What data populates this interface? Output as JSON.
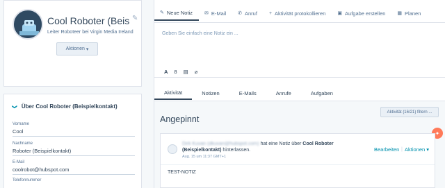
{
  "profile": {
    "name": "Cool Roboter (Beisp",
    "subtitle": "Leiter Roboteer bei Virgin Media Ireland",
    "actions_label": "Aktionen",
    "avatar_icon": "robot-avatar-icon"
  },
  "about": {
    "title": "Über Cool Roboter (Beispielkontakt)",
    "fields": [
      {
        "label": "Vorname",
        "value": "Cool"
      },
      {
        "label": "Nachname",
        "value": "Roboter (Beispielkontakt)"
      },
      {
        "label": "E-Mail",
        "value": "coolrobot@hubspot.com"
      },
      {
        "label": "Telefonnummer",
        "value": ""
      }
    ]
  },
  "top_tabs": [
    {
      "label": "Neue Notiz",
      "icon": "edit-icon"
    },
    {
      "label": "E-Mail",
      "icon": "email-icon"
    },
    {
      "label": "Anruf",
      "icon": "phone-icon"
    },
    {
      "label": "Aktivität protokollieren",
      "icon": "plus-icon"
    },
    {
      "label": "Aufgabe erstellen",
      "icon": "task-icon"
    },
    {
      "label": "Planen",
      "icon": "calendar-icon"
    }
  ],
  "note": {
    "placeholder": "Geben Sie einfach eine Notiz ein ...",
    "tools": [
      "A",
      "8",
      "▤",
      "⌀"
    ]
  },
  "sub_tabs": [
    "Aktivität",
    "Notizen",
    "E-Mails",
    "Anrufe",
    "Aufgaben"
  ],
  "activity": {
    "filter_label": "Aktivität (16/21) filtern ...",
    "pinned_title": "Angepinnt",
    "note_card": {
      "author": "Dirk Kuvan (dkuvan@hubspot.com)",
      "text_middle": "hat eine Notiz über",
      "contact": "Cool Roboter (Beispielkontakt)",
      "text_end": "hinterlassen.",
      "date": "Aug. 15 um 11:37 GMT+1",
      "edit_label": "Bearbeiten",
      "actions_label": "Aktionen",
      "body": "TEST-NOTIZ"
    }
  },
  "colors": {
    "accent": "#0091ae",
    "orange": "#ff7a59",
    "text": "#33475b"
  }
}
